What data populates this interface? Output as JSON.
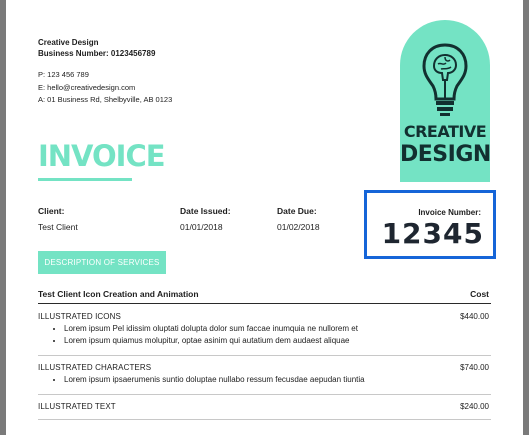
{
  "company": {
    "name": "Creative Design",
    "business_number": "Business Number: 0123456789",
    "phone": "P: 123 456 789",
    "email": "E: hello@creativedesign.com",
    "address": "A: 01 Business Rd, Shelbyville, AB 0123"
  },
  "logo": {
    "line1": "CREATIVE",
    "line2": "DESIGN",
    "icon": "lightbulb-brain-icon"
  },
  "invoice_title": "INVOICE",
  "meta": {
    "client_label": "Client:",
    "client_value": "Test Client",
    "issued_label": "Date Issued:",
    "issued_value": "01/01/2018",
    "due_label": "Date Due:",
    "due_value": "01/02/2018",
    "number_label": "Invoice Number:",
    "number_value": "12345"
  },
  "services_button": "DESCRIPTION OF SERVICES",
  "table": {
    "header_description": "Test Client Icon Creation and Animation",
    "header_cost": "Cost",
    "items": [
      {
        "name": "ILLUSTRATED ICONS",
        "price": "$440.00",
        "bullets": [
          "Lorem ipsum Pel idissim oluptati dolupta dolor sum faccae inumquia ne nullorem et",
          "Lorem ipsum quiamus molupitur, optae asinim qui autatium dem audaest aliquae"
        ]
      },
      {
        "name": "ILLUSTRATED CHARACTERS",
        "price": "$740.00",
        "bullets": [
          "Lorem ipsum ipsaerumenis suntio doluptae nullabo ressum fecusdae aepudan tiuntia"
        ]
      },
      {
        "name": "ILLUSTRATED TEXT",
        "price": "$240.00",
        "bullets": []
      }
    ]
  },
  "colors": {
    "accent": "#74e3c4",
    "highlight_border": "#1565d8",
    "logo_text": "#123030"
  }
}
